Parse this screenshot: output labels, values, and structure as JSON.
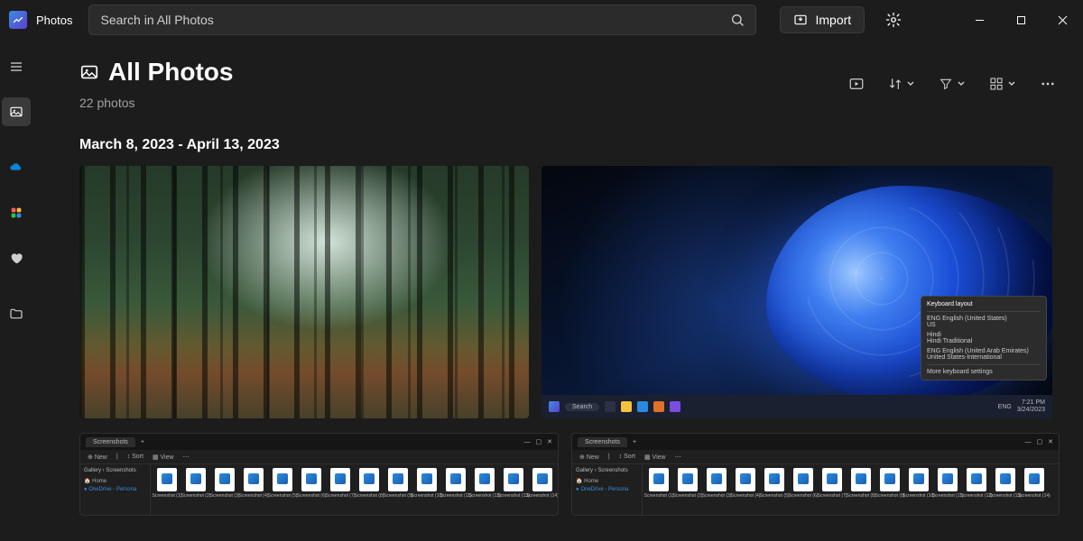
{
  "app": {
    "name": "Photos"
  },
  "search": {
    "placeholder": "Search in All Photos"
  },
  "import": {
    "label": "Import"
  },
  "sidebar": {
    "items": [
      {
        "name": "menu"
      },
      {
        "name": "all-photos"
      },
      {
        "name": "onedrive"
      },
      {
        "name": "icloud"
      },
      {
        "name": "favorites"
      },
      {
        "name": "folders"
      }
    ]
  },
  "page": {
    "title": "All Photos",
    "subtitle": "22 photos"
  },
  "dateGroup": {
    "range": "March 8, 2023 - April 13, 2023"
  },
  "kbpopup": {
    "title": "Keyboard layout",
    "items": [
      "ENG  English (United States)\nUS",
      "Hindi\nHindi Traditional",
      "ENG  English (United Arab Emirates)\nUnited States-International"
    ],
    "more": "More keyboard settings"
  },
  "taskbar": {
    "search": "Search",
    "time": "7:21 PM",
    "date": "3/24/2023",
    "lang": "ENG"
  },
  "explorer": {
    "tab": "Screenshots",
    "ribbon": [
      "New",
      "Sort",
      "View"
    ],
    "crumb": "Gallery › Screenshots",
    "side": [
      "Home",
      "OneDrive - Persona"
    ],
    "filebase": "Screenshot"
  }
}
